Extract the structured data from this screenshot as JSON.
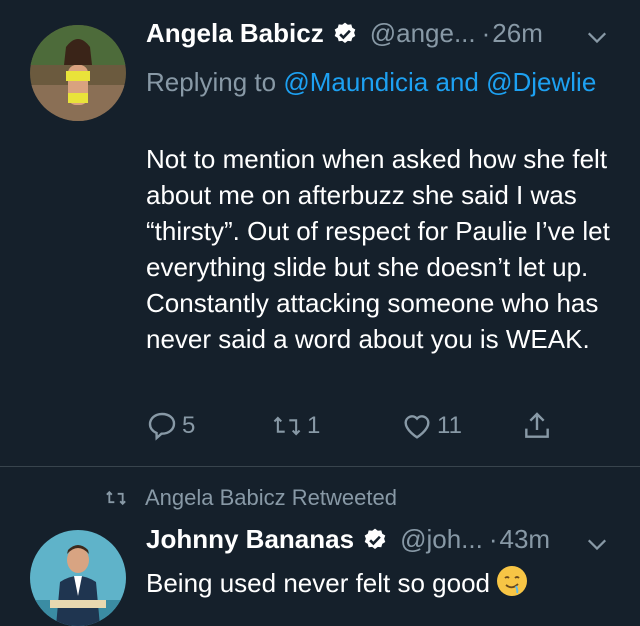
{
  "tweet1": {
    "name": "Angela Babicz",
    "handle": "@ange...",
    "dot": "·",
    "time": "26m",
    "replying_prefix": "Replying to",
    "mention1": "@Maundicia",
    "conj": "and",
    "mention2": "@Djewlie",
    "text": "Not to mention when asked how she felt about me on afterbuzz she said I was “thirsty”. Out of respect for Paulie I’ve let everything slide but she doesn’t let up. Constantly attacking someone who has never said a word about you is WEAK.",
    "reply_count": "5",
    "retweet_count": "1",
    "like_count": "11"
  },
  "tweet2": {
    "retweeted_by": "Angela Babicz Retweeted",
    "name": "Johnny Bananas",
    "handle": "@joh...",
    "dot": "·",
    "time": "43m",
    "text": "Being used never felt so good"
  },
  "icons": {
    "verified": "verified-badge-icon",
    "chevron": "chevron-down-icon",
    "reply": "reply-icon",
    "retweet": "retweet-icon",
    "like": "heart-icon",
    "share": "share-icon",
    "emoji": "drooling-face-emoji"
  },
  "colors": {
    "background": "#15202b",
    "text": "#ffffff",
    "secondary": "#8899a6",
    "link": "#1da1f2",
    "divider": "#38444d"
  }
}
